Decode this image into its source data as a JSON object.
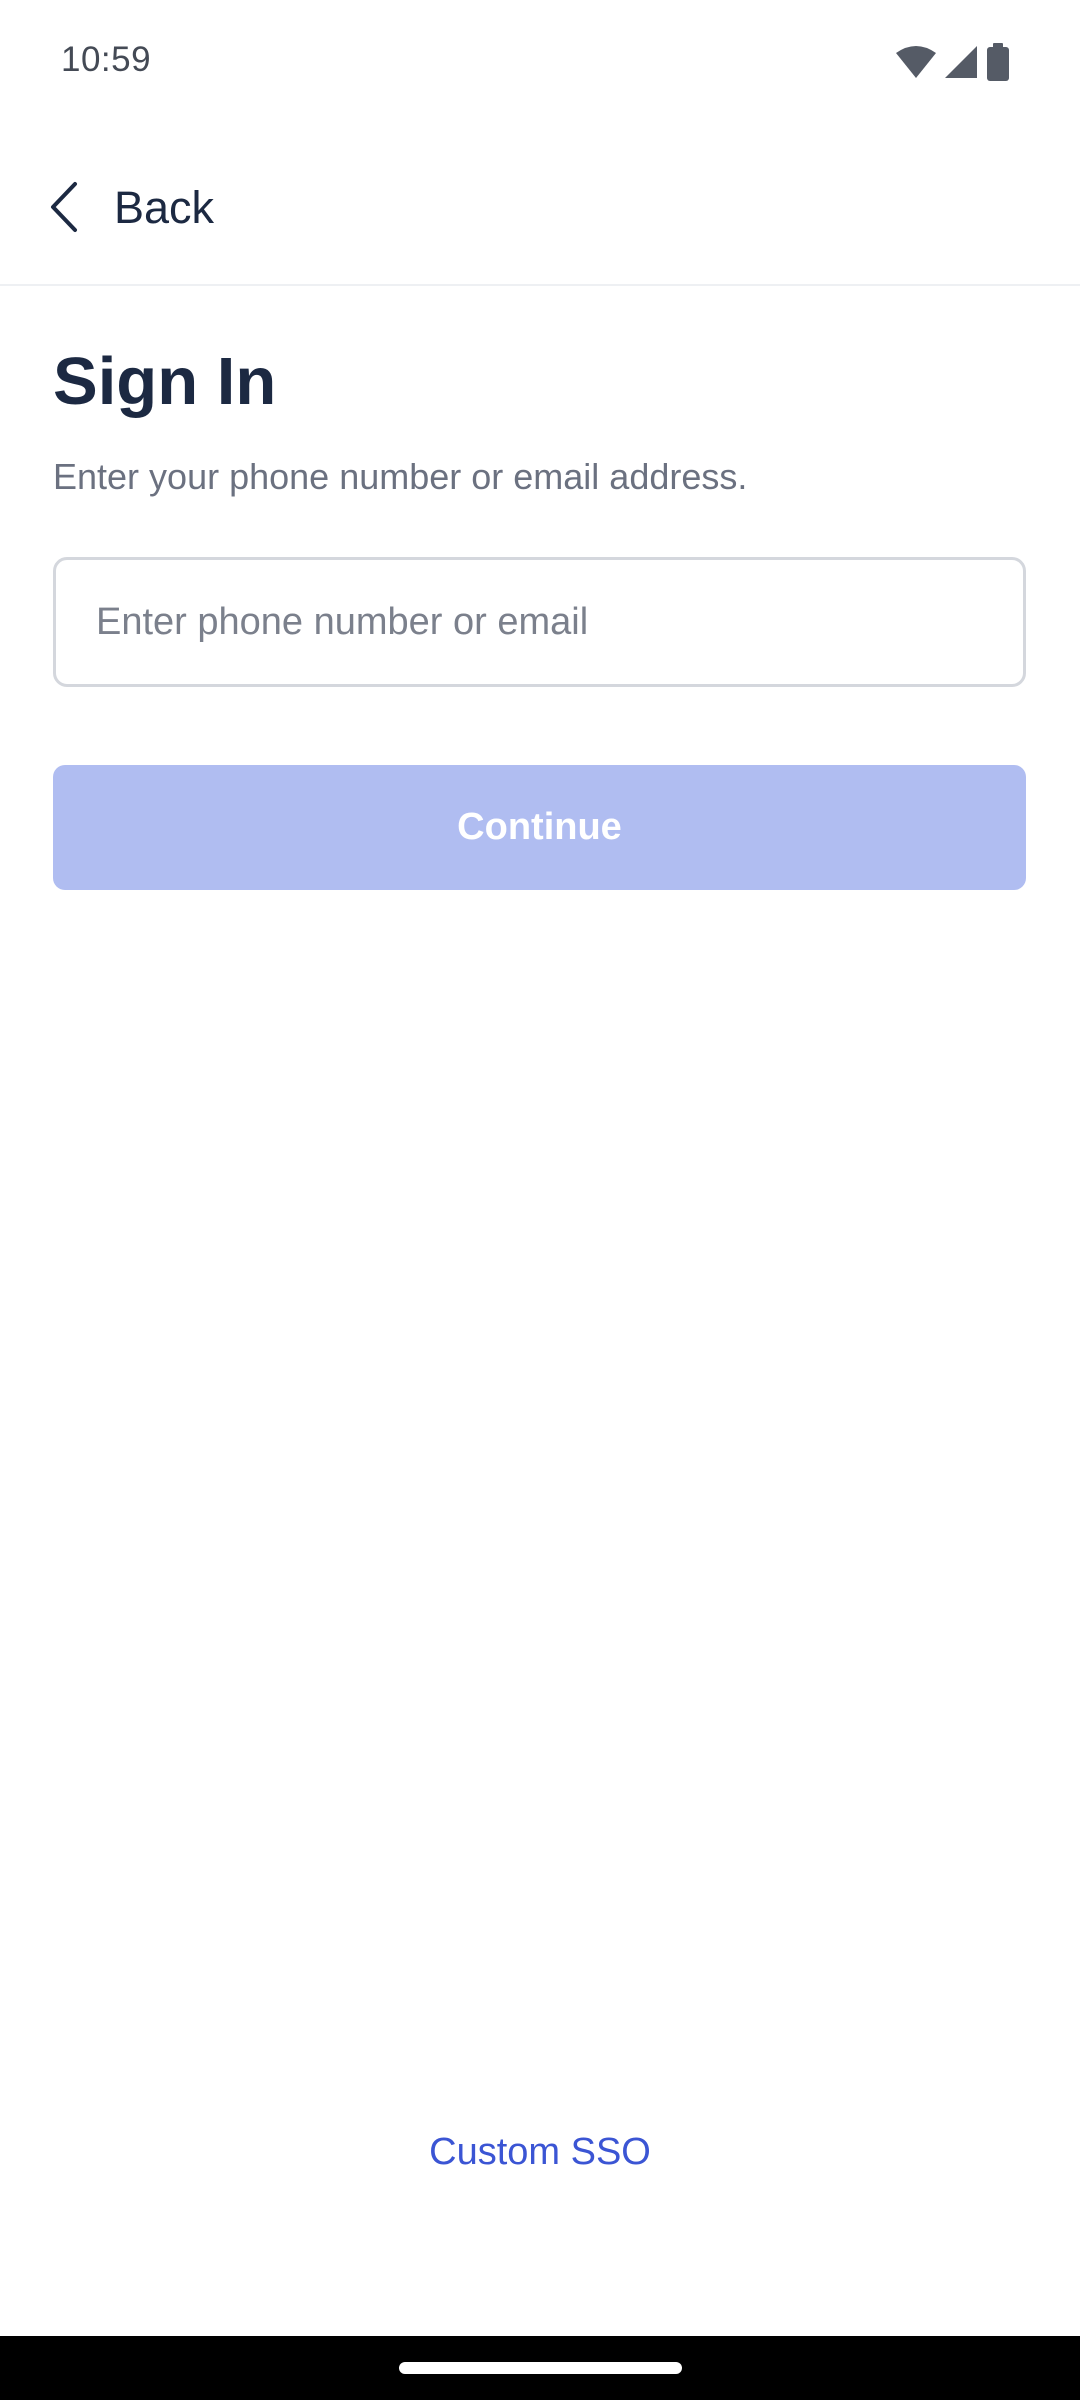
{
  "status_bar": {
    "time": "10:59",
    "icons": [
      "wifi-icon",
      "cellular-signal-icon",
      "battery-icon"
    ]
  },
  "header": {
    "back_label": "Back",
    "back_icon": "chevron-left-icon"
  },
  "main": {
    "title": "Sign In",
    "subtitle": "Enter your phone number or email address.",
    "input": {
      "value": "",
      "placeholder": "Enter phone number or email"
    },
    "continue_label": "Continue"
  },
  "footer": {
    "sso_label": "Custom SSO"
  },
  "colors": {
    "title": "#1c2942",
    "subtitle": "#6b7180",
    "button_disabled": "#b0bdf1",
    "link": "#3b55d4",
    "border": "#d4d7dd"
  }
}
